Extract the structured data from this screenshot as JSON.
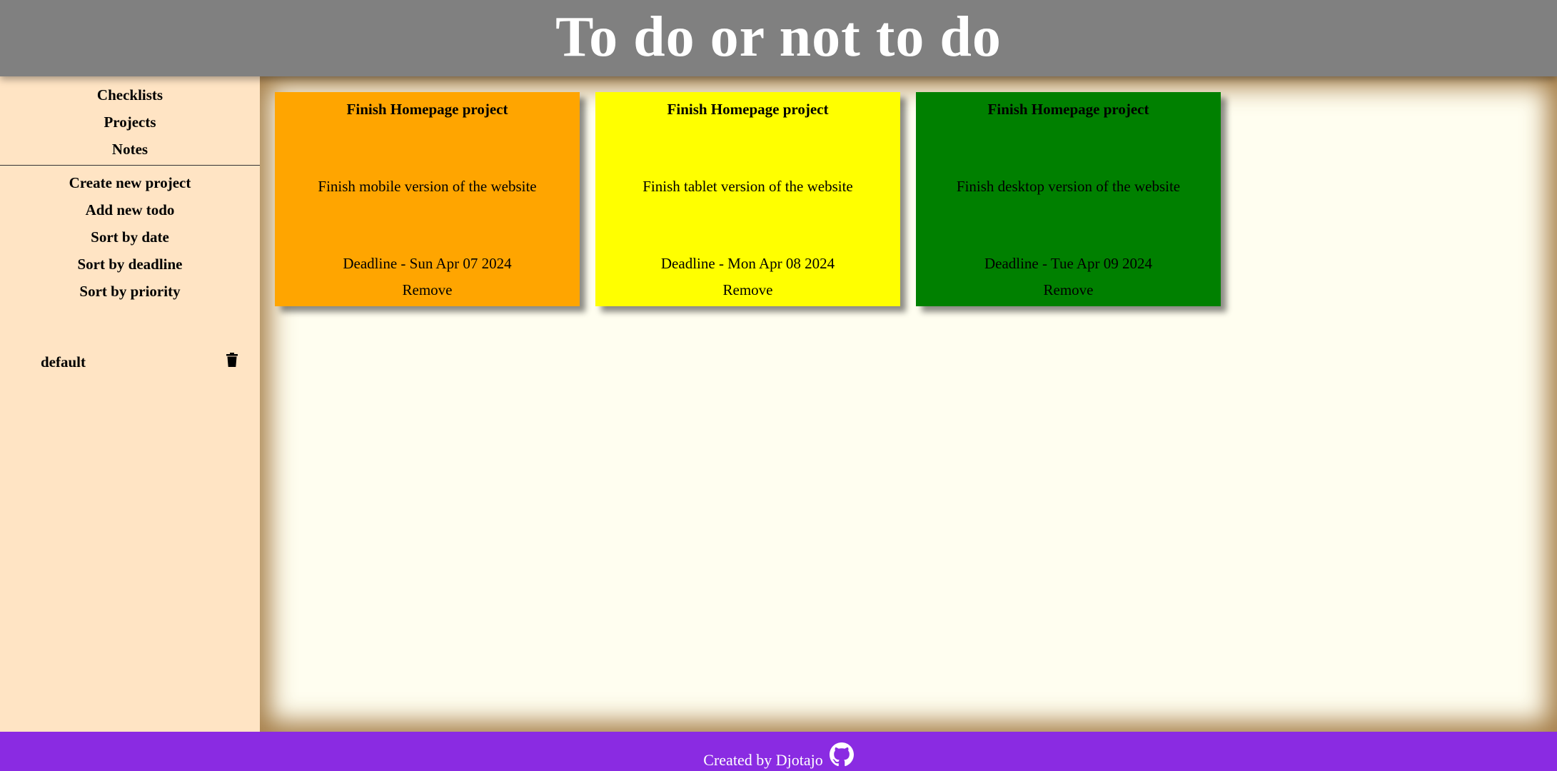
{
  "header": {
    "title": "To do or not to do"
  },
  "sidebar": {
    "nav": [
      "Checklists",
      "Projects",
      "Notes"
    ],
    "actions": [
      "Create new project",
      "Add new todo",
      "Sort by date",
      "Sort by deadline",
      "Sort by priority"
    ],
    "projects": [
      {
        "name": "default",
        "icon": "trash-icon"
      }
    ]
  },
  "todos": [
    {
      "title": "Finish Homepage project",
      "description": "Finish mobile version of the website",
      "deadline": "Deadline - Sun Apr 07 2024",
      "remove_label": "Remove",
      "color": "#ffa500"
    },
    {
      "title": "Finish Homepage project",
      "description": "Finish tablet version of the website",
      "deadline": "Deadline - Mon Apr 08 2024",
      "remove_label": "Remove",
      "color": "#ffff00"
    },
    {
      "title": "Finish Homepage project",
      "description": "Finish desktop version of the website",
      "deadline": "Deadline - Tue Apr 09 2024",
      "remove_label": "Remove",
      "color": "#008000"
    }
  ],
  "footer": {
    "text": "Created by Djotajo",
    "icon": "github-icon"
  },
  "colors": {
    "header_bg": "#808080",
    "sidebar_bg": "#ffe4c4",
    "main_bg": "#fffef0",
    "footer_bg": "#8a2be2"
  }
}
